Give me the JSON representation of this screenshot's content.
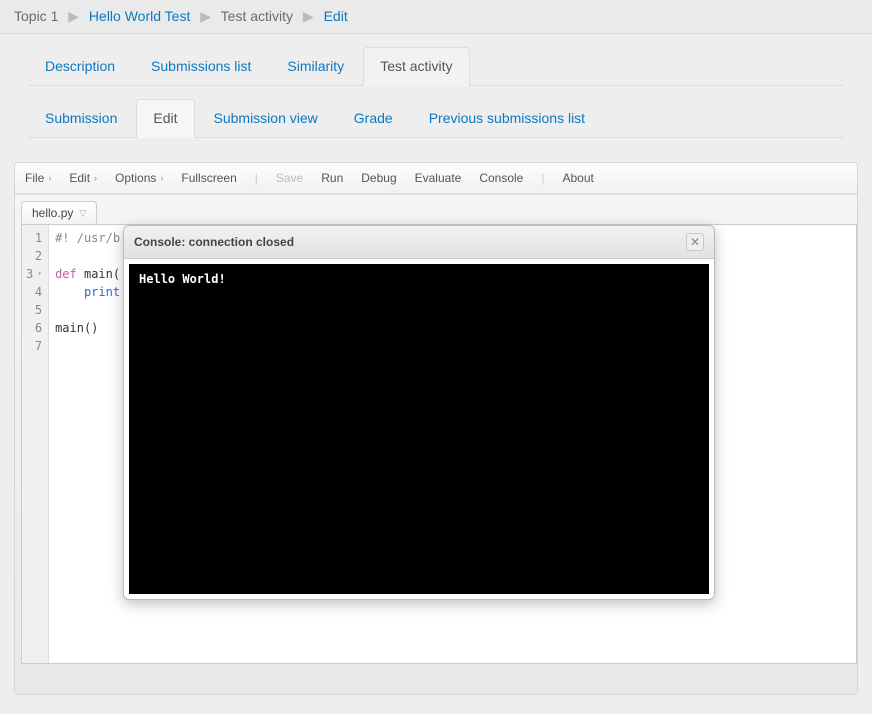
{
  "breadcrumb": {
    "items": [
      {
        "label": "Topic 1",
        "link": false
      },
      {
        "label": "Hello World Test",
        "link": true
      },
      {
        "label": "Test activity",
        "link": false
      },
      {
        "label": "Edit",
        "link": true
      }
    ]
  },
  "primary_tabs": [
    {
      "label": "Description",
      "active": false
    },
    {
      "label": "Submissions list",
      "active": false
    },
    {
      "label": "Similarity",
      "active": false
    },
    {
      "label": "Test activity",
      "active": true
    }
  ],
  "secondary_tabs": [
    {
      "label": "Submission",
      "active": false
    },
    {
      "label": "Edit",
      "active": true
    },
    {
      "label": "Submission view",
      "active": false
    },
    {
      "label": "Grade",
      "active": false
    },
    {
      "label": "Previous submissions list",
      "active": false
    }
  ],
  "toolbar": {
    "file": "File",
    "edit": "Edit",
    "options": "Options",
    "fullscreen": "Fullscreen",
    "save": "Save",
    "run": "Run",
    "debug": "Debug",
    "evaluate": "Evaluate",
    "console": "Console",
    "about": "About"
  },
  "file_tab": {
    "name": "hello.py"
  },
  "code": {
    "lines": [
      {
        "num": "1",
        "fold": false
      },
      {
        "num": "2",
        "fold": false
      },
      {
        "num": "3",
        "fold": true
      },
      {
        "num": "4",
        "fold": false
      },
      {
        "num": "5",
        "fold": false
      },
      {
        "num": "6",
        "fold": false
      },
      {
        "num": "7",
        "fold": false
      }
    ],
    "l1_comment": "#! /usr/b",
    "l3_def": "def",
    "l3_name": " main(",
    "l4_print": "    print",
    "l6_call": "main()"
  },
  "console": {
    "title": "Console: connection closed",
    "output": "Hello World!"
  }
}
